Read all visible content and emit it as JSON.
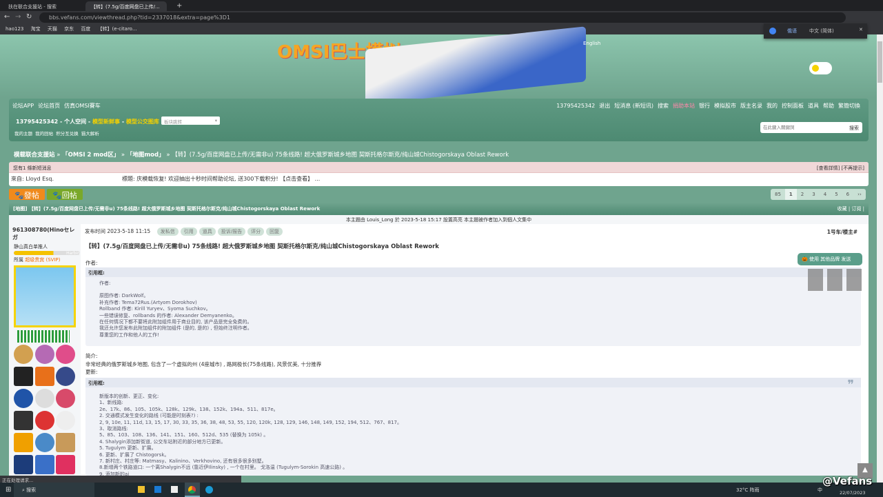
{
  "browser": {
    "tabs": [
      {
        "label": "扶在联合支援站 - 搜索"
      },
      {
        "label": "【转】(7.5g/百度网盘已上传/..."
      }
    ],
    "url": "bbs.vefans.com/viewthread.php?tid=2337018&extra=page%3D1",
    "bookmarks": [
      "hao123",
      "淘宝",
      "天猫",
      "京东",
      "百度",
      "【转】(e-citaro..."
    ]
  },
  "translate": {
    "tab1": "俄语",
    "tab2": "中文 (简体)"
  },
  "header": {
    "logo": "OMSI巴士模拟",
    "lang": "English"
  },
  "nav": {
    "left": [
      "论坛APP",
      "论坛首页",
      "仿真OMSI賽车"
    ],
    "right": [
      "13795425342",
      "退出",
      "短消息 (新短讯)",
      "搜索",
      "捐助本站",
      "银行",
      "模拟股市",
      "版主名录",
      "我的",
      "控制面板",
      "道具",
      "帮助",
      "繁簡切換"
    ],
    "user_line": "13795425342 - 个人空间 -",
    "link1": "模型新鲜事",
    "link2": "模型公交图库",
    "select": "板块跳转",
    "quick": [
      "我的主题",
      "我的回帖",
      "积分互兑换",
      "猫大解析"
    ],
    "search_placeholder": "在此鍵入關鍵詞",
    "search_btn": "搜索"
  },
  "breadcrumb": {
    "home": "模载联合支援站",
    "c1": "「OMSI 2 mod区」",
    "c2": "「地图mod」",
    "title": "【转】(7.5g/百度网盘已上传/无需非u) 75条线路! 超大俄罗斯城乡地图 契斯托格尔斯克/纯山城Chistogorskaya Oblast Rework"
  },
  "message": {
    "head": "您有1 條新短消息",
    "actions": "[查看詳情] [不再提示]",
    "from": "來自: Lloyd Esq.",
    "subject": "標題: 庆模载恢复! 欢迎抽出十秒时间帮助论坛, 送300下载积分! 【点击查看】 ..."
  },
  "buttons": {
    "post": "發帖",
    "reply": "回帖"
  },
  "pager": [
    "85",
    "1",
    "2",
    "3",
    "4",
    "5",
    "6",
    "››"
  ],
  "thread": {
    "title": "[地图] 【转】(7.5g/百度网盘已上传/无需非u) 75条线路! 超大俄罗斯城乡地图 契斯托格尔斯克/纯山城Chistogorskaya Oblast Rework",
    "fav": "收藏",
    "sub": "订阅",
    "note": "本主題由 Louis_Long 於 2023-5-18 15:17 設置高亮 本主題被作者加入到個人文集中"
  },
  "user": {
    "name": "961308780(Hinoセレガ",
    "rank": "静山真白单推人",
    "group_label": "所属",
    "group": "超级贵宾 (SVIP)",
    "bar_text": "Harbin"
  },
  "post": {
    "time": "发布时间 2023-5-18 11:15",
    "actions": [
      "发私信",
      "引用",
      "道具",
      "投诉/报告",
      "评分",
      "回复"
    ],
    "floor": "1号车/楼主#",
    "title": "【转】(7.5g/百度网盘已上传/无需非u) 75条线路! 超大俄罗斯城乡地图 契斯托格尔斯克/纯山城Chistogorskaya Oblast Rework",
    "author_label": "作者:",
    "quote_label": "引用框:",
    "q1": [
      "作者:",
      "",
      "原图作者: DarkWolf。",
      "补充作者: Tema72Rus.(Artyom Dorokhov)",
      "Rollband 作者: Kirill Yuryev、Syoma Suchkov。",
      "一些错误修复、rollbands 的作者: Alexander Demyanenko。",
      "在任何情况下都不要将此附加组件用于商业目的, 该产品是完全免费的。",
      "我还允许您发布此附加组件的附加组件 (是的, 是的) , 但始终注明作者。",
      "尊重您的工作和他人的工作!"
    ],
    "intro_label": "简介:",
    "intro": "非常经典的俄罗斯城乡地图, 包含了一个虚拟的州 (4座城市) , 路网极长(75条线路), 风景优美, 十分推荐",
    "update_label": "更新:",
    "q2": [
      "新版本的创新、更正、变化:",
      "1、新线路:",
      "2e、17k、86、105、105k、128k、129k、138、152k、194a、511、817e。",
      "2. 交通模式发生变化的路线 (可能是时刻表?) :",
      "2, 9, 10e, 11, 11d, 13, 15, 17, 30, 33, 35, 36, 38, 48, 53, 55, 120, 120k, 128, 129, 146, 148, 149, 152, 194, 512、767、817。",
      "3、取消路线:",
      "5、85、103、108、136、141、151、160、512d、535 (替换为 105k) 。",
      "4. Shalygin添加新街道, 公交车站附近的部分地方已更新。",
      "5. Tugulym 更新、扩展。",
      "6. 更新、扩展了 Chistogorsk。",
      "7. 新村庄、村庄等: Matmasy、Kalinino、Verkhovino, 还有很多很多别墅。",
      "8.新增两个铁路道口: 一个离Shalygin不远 (靠近伊Ilinsky) , 一个在村里。 戈洛温 (Tugulym-Sorokin 高速公路) 。",
      "9. 添加新的ai"
    ],
    "share": "使用 其他品牌 发送"
  },
  "status": "正在处理请求...",
  "taskbar": {
    "search": "搜索",
    "weather": "32°C 阵雨",
    "ime": "中",
    "date": "22/07/2023",
    "watermark": "@Vefans"
  },
  "colors": {
    "teal": "#6fa48e",
    "orange": "#f08a1c",
    "green": "#7aa82a"
  }
}
